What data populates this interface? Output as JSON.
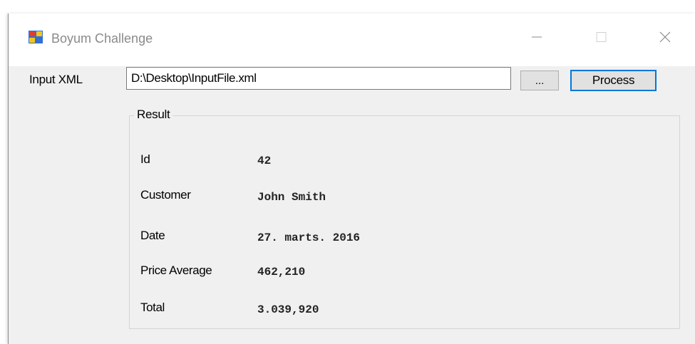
{
  "window": {
    "title": "Boyum Challenge",
    "controls": {
      "minimize": "minimize",
      "maximize": "maximize",
      "close": "close"
    }
  },
  "input": {
    "label": "Input XML",
    "value": "D:\\Desktop\\InputFile.xml"
  },
  "buttons": {
    "browse": "...",
    "process": "Process"
  },
  "result": {
    "legend": "Result",
    "fields": [
      {
        "label": "Id",
        "value": "42"
      },
      {
        "label": "Customer",
        "value": "John Smith"
      },
      {
        "label": "Date",
        "value": "27. marts. 2016"
      },
      {
        "label": "Price Average",
        "value": "462,210"
      },
      {
        "label": "Total",
        "value": "3.039,920"
      }
    ]
  },
  "colors": {
    "accent": "#0078d7",
    "window_bg": "#f0f0f0",
    "title_bg": "#ffffff"
  },
  "icons": {
    "app": "app-icon",
    "minimize": "minimize-icon",
    "maximize": "maximize-icon",
    "close": "close-icon"
  }
}
